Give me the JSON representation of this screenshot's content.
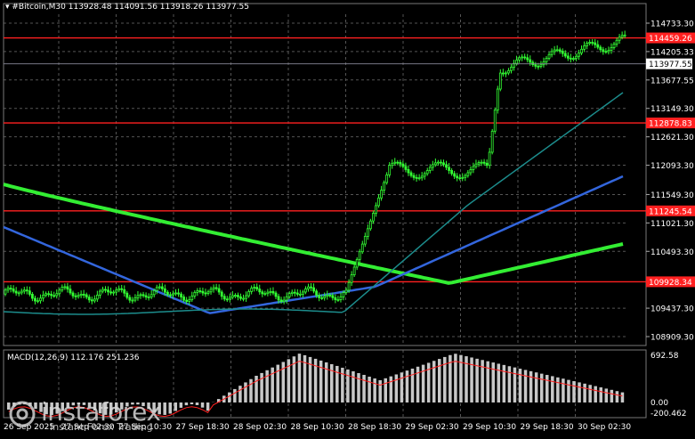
{
  "header": {
    "symbol": "#Bitcoin,M30",
    "ohlc": "113928.48 114091.56 113918.26 113977.55"
  },
  "macd": {
    "label": "MACD(12,26,9) 112.176 251.236",
    "scale": [
      "692.58",
      "0.00",
      "-200.462"
    ]
  },
  "price_axis": [
    "114733.30",
    "114205.33",
    "113677.55",
    "113149.30",
    "112621.30",
    "112093.30",
    "111549.30",
    "111021.30",
    "110493.30",
    "109437.30",
    "108909.30"
  ],
  "levels": [
    {
      "value": "114459.26",
      "color": "#ff2020"
    },
    {
      "value": "112878.83",
      "color": "#ff2020"
    },
    {
      "value": "111245.54",
      "color": "#ff2020"
    },
    {
      "value": "109928.34",
      "color": "#ff2020"
    }
  ],
  "current_price": "113977.55",
  "time_axis": [
    "26 Sep 2025",
    "27 Sep 02:30",
    "27 Sep 10:30",
    "27 Sep 18:30",
    "28 Sep 02:30",
    "28 Sep 10:30",
    "28 Sep 18:30",
    "29 Sep 02:30",
    "29 Sep 10:30",
    "29 Sep 18:30",
    "30 Sep 02:30"
  ],
  "brand": {
    "name": "instaforex",
    "tagline": "Instant Forex Trading"
  },
  "colors": {
    "grid": "#555555",
    "candle": "#33ff33",
    "ma_slow": "#33ee33",
    "ma_mid": "#3366dd",
    "ma_fast": "#1c8c8c",
    "level": "#ff2020",
    "hist": "#c8c8c8",
    "signal": "#ff2020"
  }
}
